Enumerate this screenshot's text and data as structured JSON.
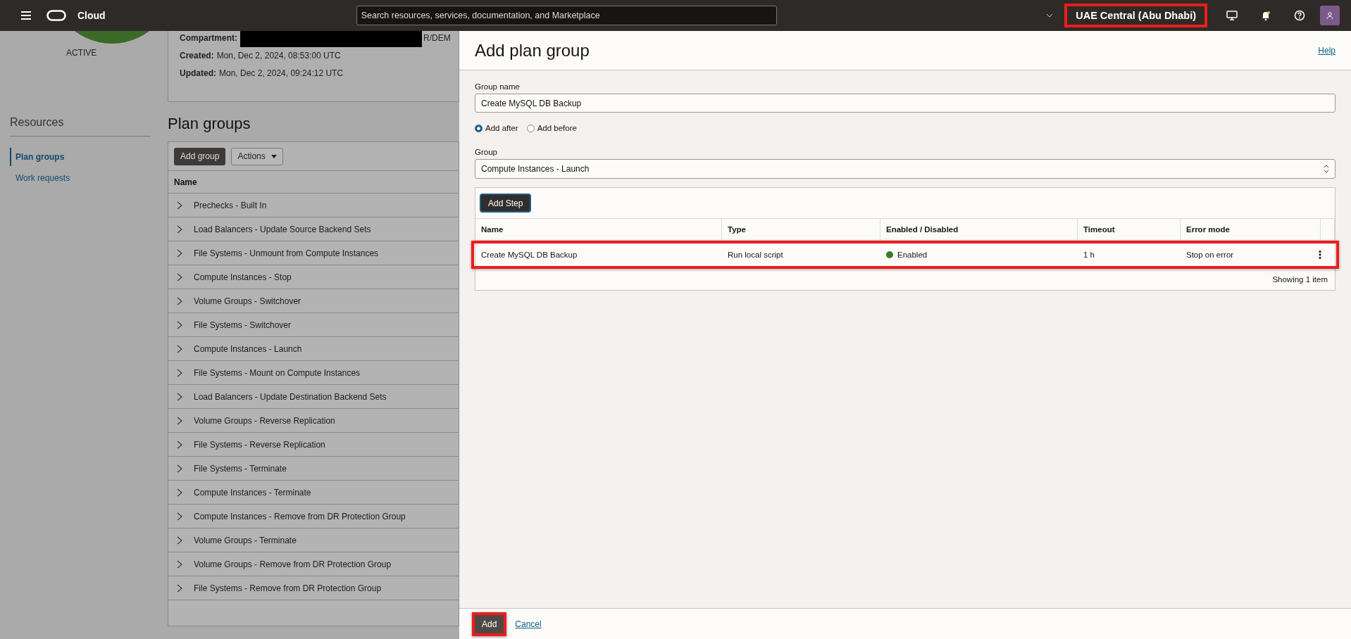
{
  "topbar": {
    "brand": "Cloud",
    "search": {
      "placeholder": "Search resources, services, documentation, and Marketplace"
    },
    "region": {
      "label": "UAE Central (Abu Dhabi)",
      "highlighted": true
    }
  },
  "details": {
    "status": "ACTIVE",
    "fields": [
      {
        "label": "Compartment:",
        "value": "R/DEM",
        "redacted": true
      },
      {
        "label": "Created:",
        "value": "Mon, Dec 2, 2024, 08:53:00 UTC",
        "redacted": false
      },
      {
        "label": "Updated:",
        "value": "Mon, Dec 2, 2024, 09:24:12 UTC",
        "redacted": false
      }
    ]
  },
  "sidebar": {
    "title": "Resources",
    "items": [
      {
        "label": "Plan groups",
        "selected": true
      },
      {
        "label": "Work requests",
        "selected": false
      }
    ]
  },
  "plan_groups": {
    "title": "Plan groups",
    "add_button": "Add group",
    "actions_button": "Actions",
    "column": "Name",
    "rows": [
      "Prechecks - Built In",
      "Load Balancers - Update Source Backend Sets",
      "File Systems - Unmount from Compute Instances",
      "Compute Instances - Stop",
      "Volume Groups - Switchover",
      "File Systems - Switchover",
      "Compute Instances - Launch",
      "File Systems - Mount on Compute Instances",
      "Load Balancers - Update Destination Backend Sets",
      "Volume Groups - Reverse Replication",
      "File Systems - Reverse Replication",
      "File Systems - Terminate",
      "Compute Instances - Terminate",
      "Compute Instances - Remove from DR Protection Group",
      "Volume Groups - Terminate",
      "Volume Groups - Remove from DR Protection Group",
      "File Systems - Remove from DR Protection Group"
    ]
  },
  "panel": {
    "title": "Add plan group",
    "help": "Help",
    "group_name": {
      "label": "Group name",
      "value": "Create MySQL DB Backup"
    },
    "position": [
      {
        "label": "Add after",
        "selected": true
      },
      {
        "label": "Add before",
        "selected": false
      }
    ],
    "group": {
      "label": "Group",
      "value": "Compute Instances - Launch"
    },
    "steps": {
      "add_button": "Add Step",
      "columns": [
        "Name",
        "Type",
        "Enabled / Disabled",
        "Timeout",
        "Error mode"
      ],
      "rows": [
        {
          "name": "Create MySQL DB Backup",
          "type": "Run local script",
          "status": "Enabled",
          "enabled": true,
          "timeout": "1 h",
          "error_mode": "Stop on error",
          "highlighted": true
        }
      ],
      "footer": "Showing 1 item"
    },
    "footer": {
      "primary": {
        "label": "Add",
        "highlighted": true
      },
      "cancel": "Cancel"
    }
  }
}
